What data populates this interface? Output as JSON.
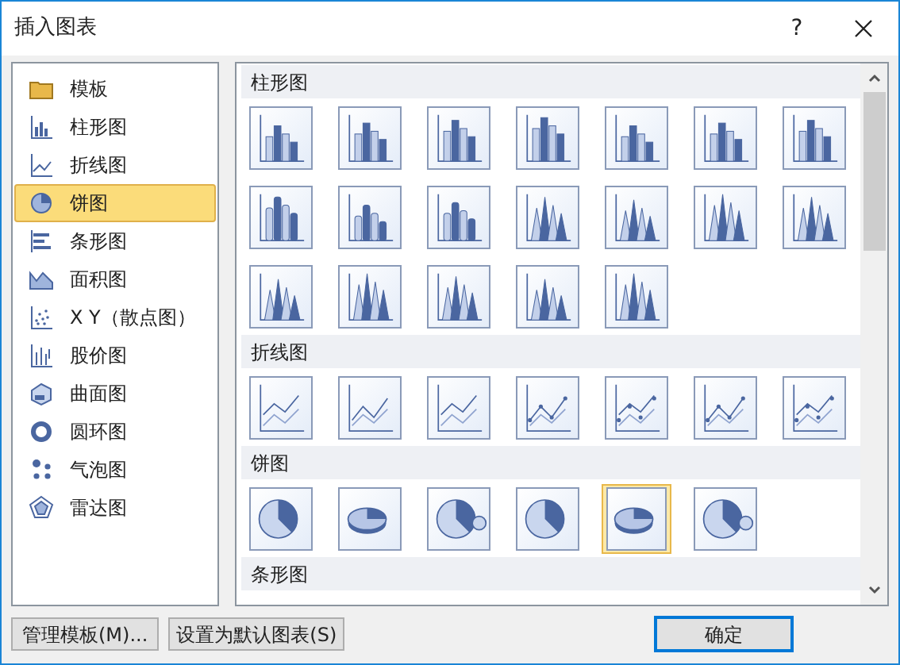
{
  "window": {
    "title": "插入图表",
    "help": "?"
  },
  "sidebar": {
    "items": [
      {
        "label": "模板",
        "kind": "folder",
        "selected": false
      },
      {
        "label": "柱形图",
        "kind": "column",
        "selected": false
      },
      {
        "label": "折线图",
        "kind": "line",
        "selected": false
      },
      {
        "label": "饼图",
        "kind": "pie",
        "selected": true
      },
      {
        "label": "条形图",
        "kind": "bar",
        "selected": false
      },
      {
        "label": "面积图",
        "kind": "area",
        "selected": false
      },
      {
        "label": "X Y（散点图）",
        "kind": "scatter",
        "selected": false
      },
      {
        "label": "股价图",
        "kind": "stock",
        "selected": false
      },
      {
        "label": "曲面图",
        "kind": "surface",
        "selected": false
      },
      {
        "label": "圆环图",
        "kind": "doughnut",
        "selected": false
      },
      {
        "label": "气泡图",
        "kind": "bubble",
        "selected": false
      },
      {
        "label": "雷达图",
        "kind": "radar",
        "selected": false
      }
    ]
  },
  "gallery": [
    {
      "title": "柱形图",
      "kind": "column",
      "items": [
        {
          "selected": false
        },
        {
          "selected": false
        },
        {
          "selected": false
        },
        {
          "selected": false
        },
        {
          "selected": false
        },
        {
          "selected": false
        },
        {
          "selected": false
        },
        {
          "selected": false
        },
        {
          "selected": false
        },
        {
          "selected": false
        },
        {
          "selected": false
        },
        {
          "selected": false
        },
        {
          "selected": false
        },
        {
          "selected": false
        },
        {
          "selected": false
        },
        {
          "selected": false
        },
        {
          "selected": false
        },
        {
          "selected": false
        },
        {
          "selected": false
        }
      ]
    },
    {
      "title": "折线图",
      "kind": "line",
      "items": [
        {
          "selected": false
        },
        {
          "selected": false
        },
        {
          "selected": false
        },
        {
          "selected": false
        },
        {
          "selected": false
        },
        {
          "selected": false
        },
        {
          "selected": false
        }
      ]
    },
    {
      "title": "饼图",
      "kind": "pie",
      "items": [
        {
          "selected": false
        },
        {
          "selected": false
        },
        {
          "selected": false
        },
        {
          "selected": false
        },
        {
          "selected": true
        },
        {
          "selected": false
        }
      ]
    },
    {
      "title": "条形图"
    }
  ],
  "buttons": {
    "manage": "管理模板(M)...",
    "set_default": "设置为默认图表(S)",
    "ok": "确定"
  }
}
